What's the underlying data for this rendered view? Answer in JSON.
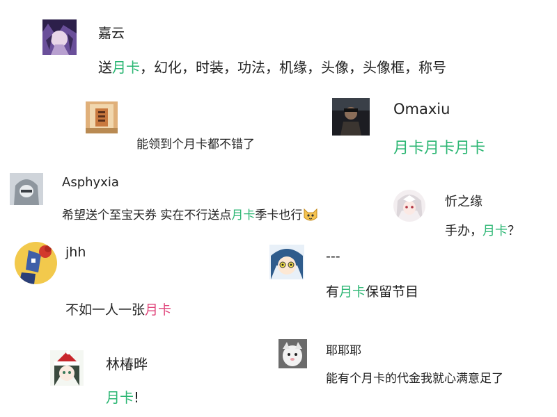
{
  "colors": {
    "highlight_green": "#2bb673",
    "highlight_pink": "#e0457b",
    "text": "#222222"
  },
  "comments": [
    {
      "username": "嘉云",
      "avatar_icon": "anime-avatar-icon",
      "message": {
        "pre": "送",
        "highlight": "月卡",
        "post": "，幻化，时装，功法，机缘，头像，头像框，称号"
      }
    },
    {
      "username": "",
      "avatar_icon": "photo-avatar-icon",
      "message": {
        "pre": "能领到个",
        "highlight": "",
        "post": "月卡都不错了"
      }
    },
    {
      "username": "Omaxiu",
      "avatar_icon": "portrait-avatar-icon",
      "message": {
        "pre": "",
        "highlight": "月卡月卡月卡",
        "post": ""
      }
    },
    {
      "username": "Asphyxia",
      "avatar_icon": "hooded-avatar-icon",
      "message": {
        "pre": "希望送个至宝天券 实在不行送点",
        "highlight": "月卡",
        "post": "季卡也行",
        "emoji": "cat-emoji-icon"
      }
    },
    {
      "username": "忻之缘",
      "avatar_icon": "white-hair-avatar-icon",
      "message": {
        "pre": "手办，",
        "highlight": "月卡",
        "post": "？"
      }
    },
    {
      "username": "jhh",
      "avatar_icon": "cartoon-avatar-icon",
      "message": {
        "pre": "不如一人一张",
        "highlight": "月卡",
        "post": ""
      }
    },
    {
      "username": "---",
      "avatar_icon": "blue-hair-avatar-icon",
      "message": {
        "pre": "有",
        "highlight": "月卡",
        "post": "保留节目"
      }
    },
    {
      "username": "林椿晔",
      "avatar_icon": "santa-hat-avatar-icon",
      "message": {
        "pre": "",
        "highlight": "月卡",
        "post": "!"
      }
    },
    {
      "username": "耶耶耶",
      "avatar_icon": "pet-photo-avatar-icon",
      "message": {
        "pre": "能有个月卡的代金我就心满意足了",
        "highlight": "",
        "post": ""
      }
    }
  ]
}
